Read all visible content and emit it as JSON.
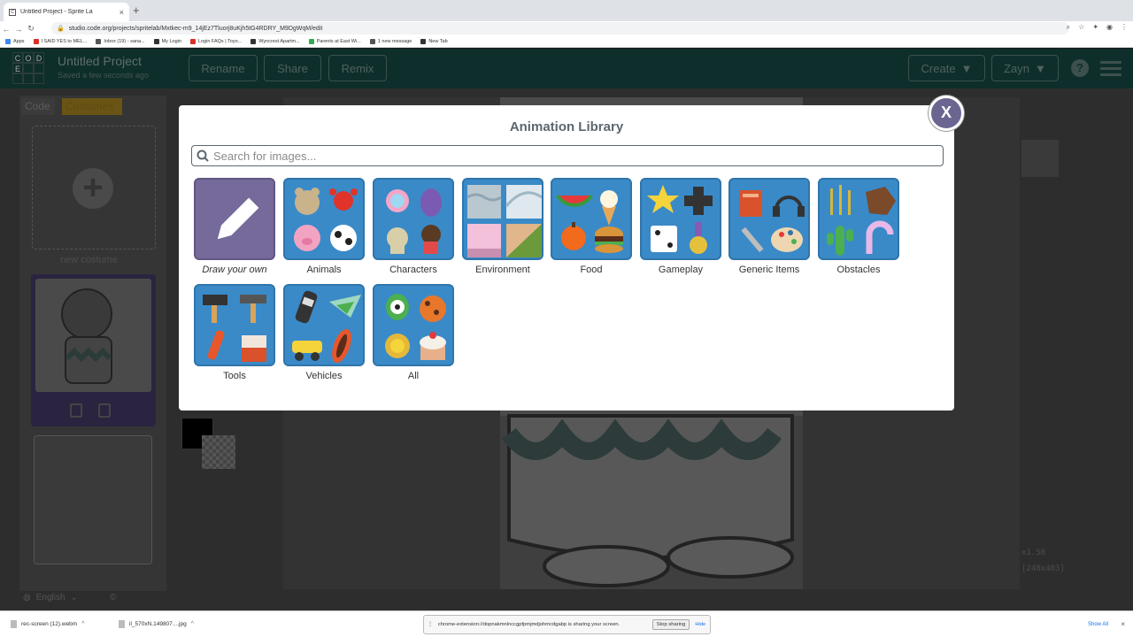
{
  "browser": {
    "tab_title": "Untitled Project - Sprite La",
    "tab_favicon": "C",
    "url": "studio.code.org/projects/spritelab/Mxtkec-m9_14jEz7Tluorj8uKjh5tG4RDRY_M9DgWqM/edit",
    "bookmarks": [
      {
        "label": "Apps",
        "color": "#4285f4"
      },
      {
        "label": "I SAID YES to MEL...",
        "color": "#d93025"
      },
      {
        "label": "Inbox (19) - sana...",
        "color": "#555555"
      },
      {
        "label": "My Login",
        "color": "#333333"
      },
      {
        "label": "Login FAQs | Toyo...",
        "color": "#d93025"
      },
      {
        "label": "Wyncrest Apartm...",
        "color": "#333333"
      },
      {
        "label": "Parents at East Wi...",
        "color": "#34a853"
      },
      {
        "label": "1 new message",
        "color": "#555555"
      },
      {
        "label": "New Tab",
        "color": "#333333"
      }
    ]
  },
  "header": {
    "logo_letters": [
      "C",
      "O",
      "D",
      "E",
      "",
      "",
      "",
      "",
      ""
    ],
    "project_title": "Untitled Project",
    "saved_status": "Saved a few seconds ago",
    "rename_label": "Rename",
    "share_label": "Share",
    "remix_label": "Remix",
    "create_label": "Create",
    "user_label": "Zayn",
    "help_label": "?"
  },
  "workspace": {
    "tab_code": "Code",
    "tab_costumes": "Costumes",
    "new_costume_label": "new costume",
    "language": "English",
    "copyright": "©",
    "scale_text": "x1.58",
    "size_text": "[248x403]"
  },
  "modal": {
    "title": "Animation Library",
    "close_label": "X",
    "search_placeholder": "Search for images...",
    "categories": [
      {
        "label": "Draw your own"
      },
      {
        "label": "Animals"
      },
      {
        "label": "Characters"
      },
      {
        "label": "Environment"
      },
      {
        "label": "Food"
      },
      {
        "label": "Gameplay"
      },
      {
        "label": "Generic Items"
      },
      {
        "label": "Obstacles"
      },
      {
        "label": "Tools"
      },
      {
        "label": "Vehicles"
      },
      {
        "label": "All"
      }
    ]
  },
  "downloads": {
    "items": [
      {
        "label": "rec-screen (12).webm"
      },
      {
        "label": "il_570xN.149807....jpg"
      }
    ],
    "show_all": "Show All"
  },
  "share_bar": {
    "message": "chrome-extension://dopnakmnlnccgpfpmjmdjohmcdgabp is sharing your screen.",
    "stop_label": "Stop sharing",
    "hide_label": "Hide"
  },
  "colors": {
    "modal_tile": "#3a8ac8",
    "draw_tile": "#766a9b",
    "close_button": "#6b6691",
    "title_text": "#5b6770"
  }
}
